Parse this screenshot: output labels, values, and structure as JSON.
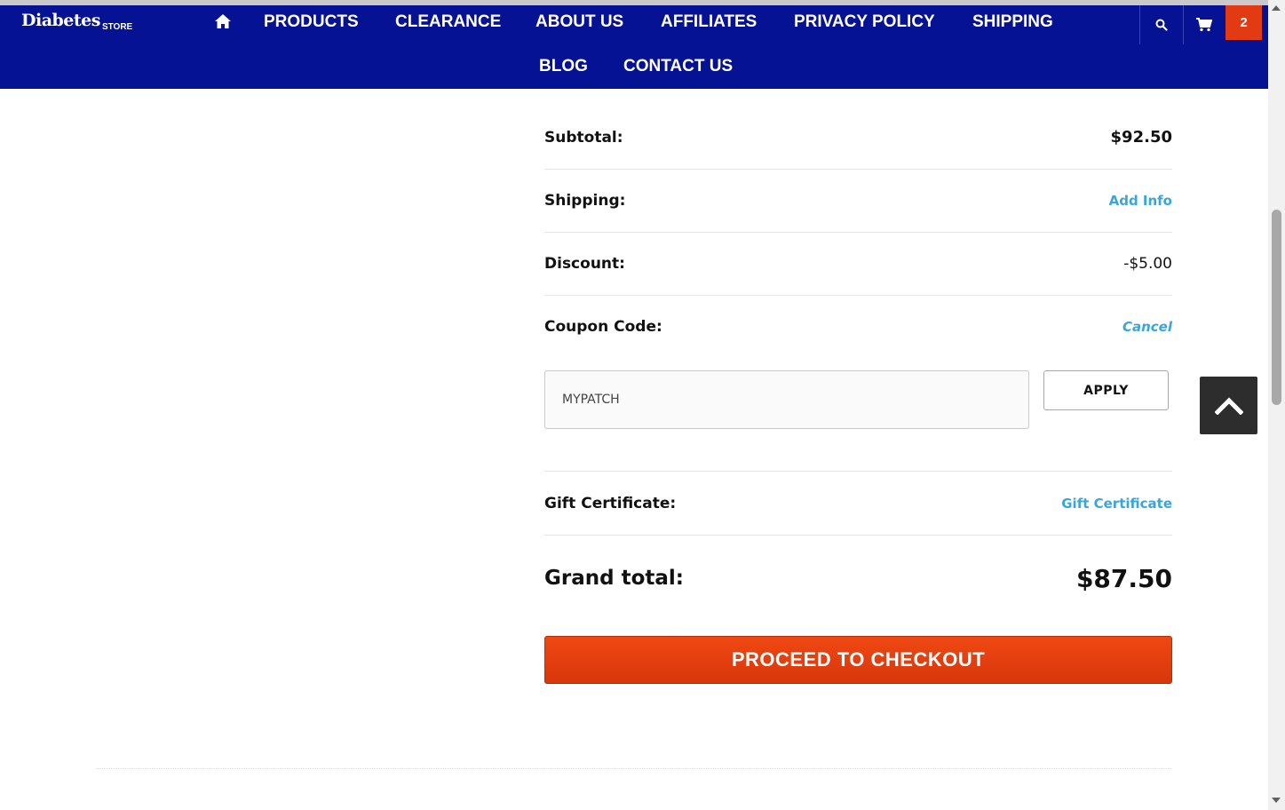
{
  "header": {
    "logo_main": "Diabetes",
    "logo_sub": "STORE",
    "nav": [
      "PRODUCTS",
      "CLEARANCE",
      "ABOUT US",
      "AFFILIATES",
      "PRIVACY POLICY",
      "SHIPPING",
      "BLOG",
      "CONTACT US"
    ],
    "cart_count": "2",
    "colors": {
      "nav_bg": "#061294",
      "cart_badge": "#e23a12"
    }
  },
  "summary": {
    "subtotal_label": "Subtotal:",
    "subtotal_value": "$92.50",
    "shipping_label": "Shipping:",
    "shipping_link": "Add Info",
    "discount_label": "Discount:",
    "discount_value": "-$5.00",
    "coupon_label": "Coupon Code:",
    "coupon_cancel": "Cancel",
    "coupon_value": "MYPATCH",
    "apply_label": "APPLY",
    "gift_label": "Gift Certificate:",
    "gift_link": "Gift Certificate",
    "grand_label": "Grand total:",
    "grand_value": "$87.50",
    "checkout_label": "PROCEED TO CHECKOUT",
    "colors": {
      "link": "#3aa5da",
      "checkout": "#e54010"
    }
  },
  "icons": {
    "home": "home-icon",
    "search": "search-icon",
    "cart": "cart-icon",
    "back_to_top": "chevron-up-icon"
  }
}
